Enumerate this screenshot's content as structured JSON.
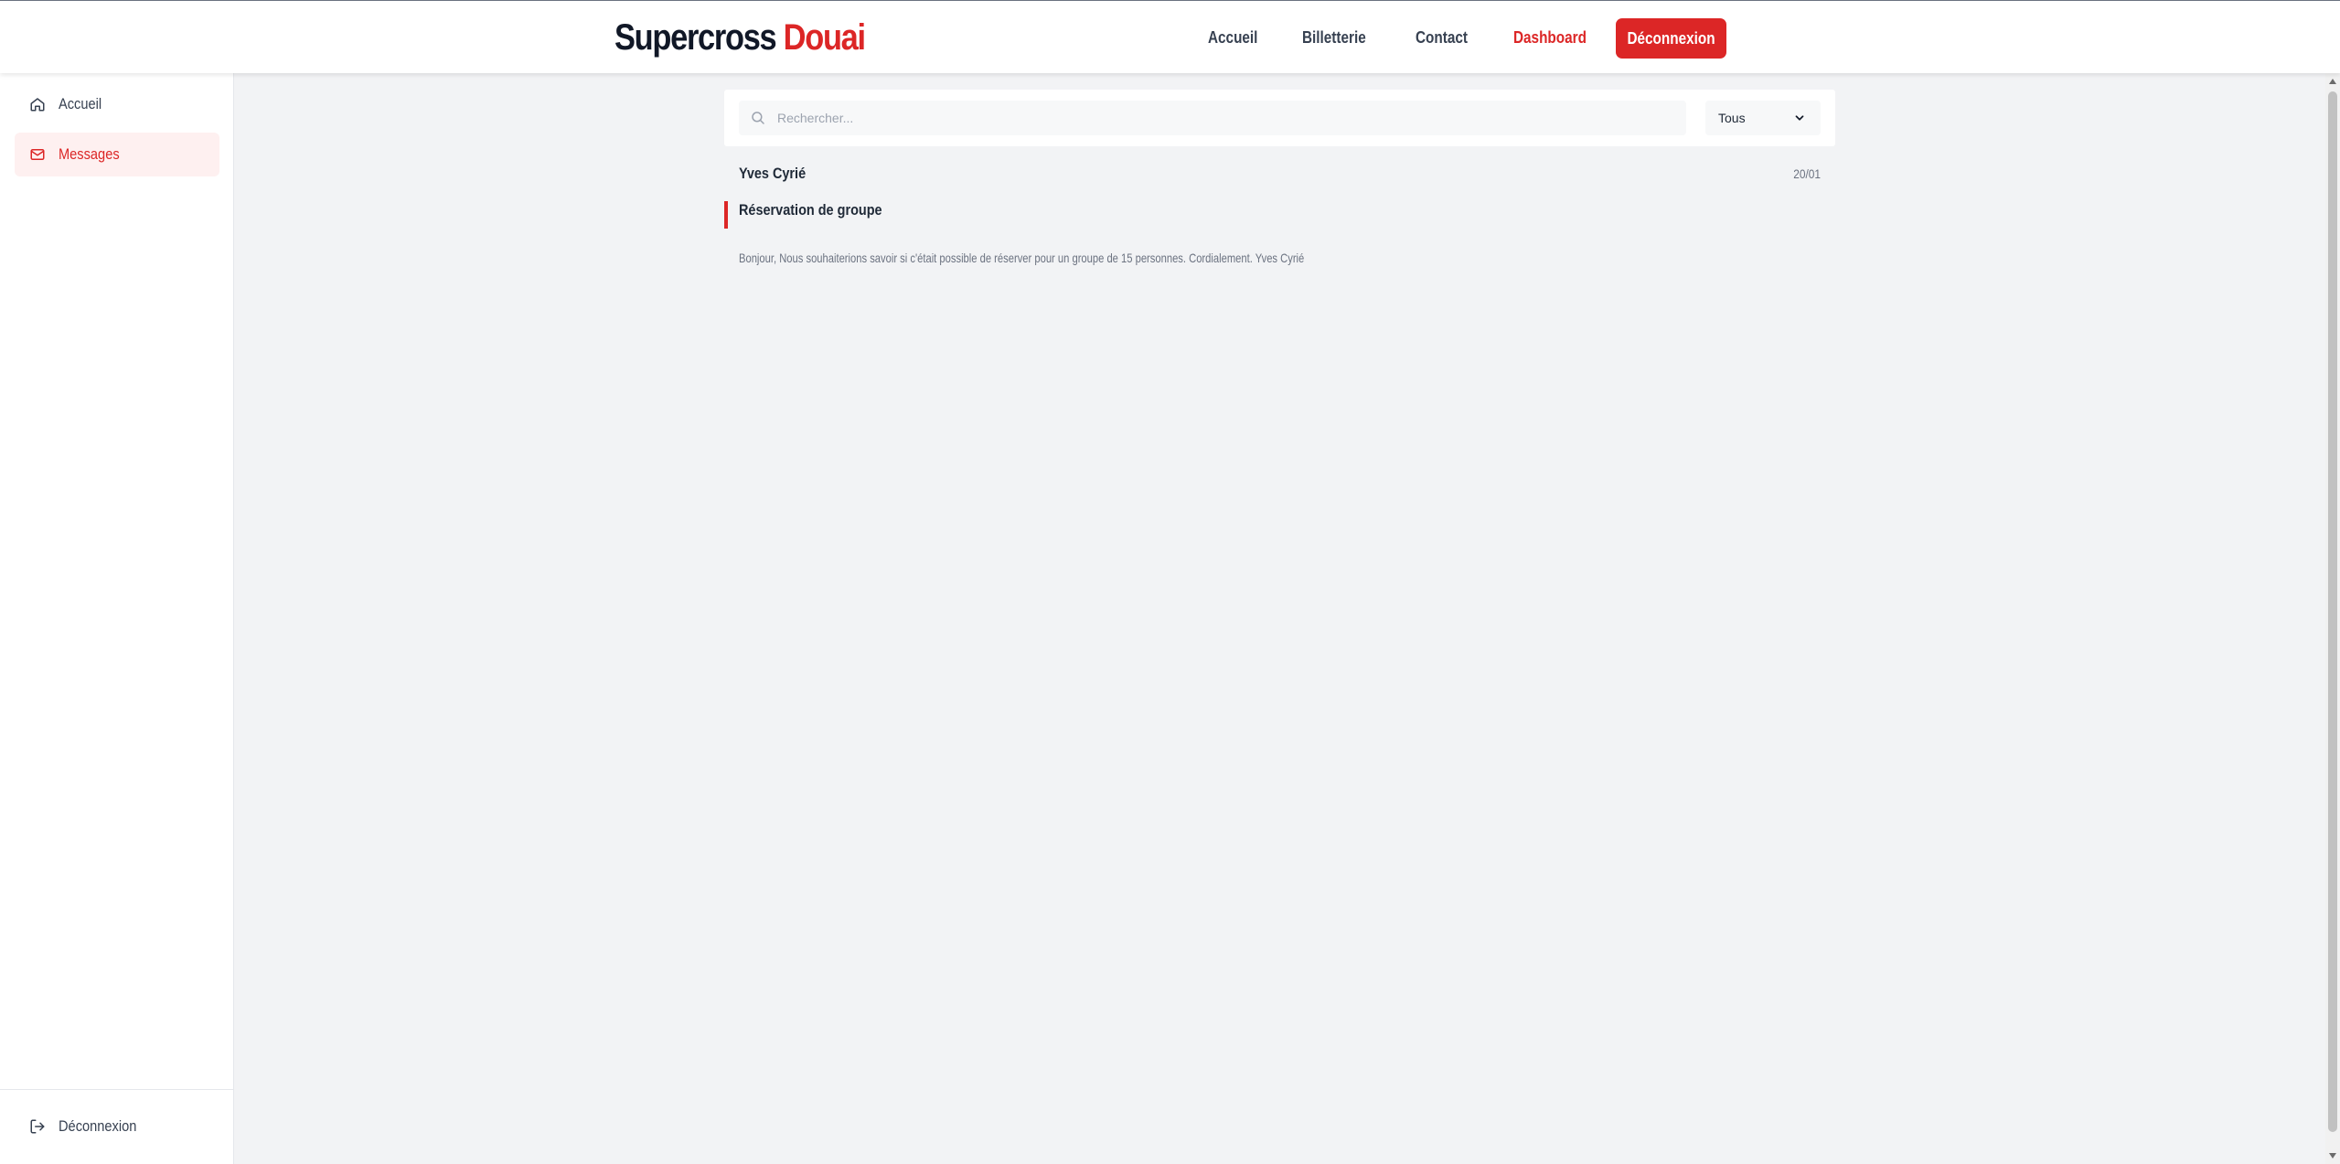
{
  "header": {
    "brand_primary": "Supercross",
    "brand_accent": "Douai",
    "nav": [
      "Accueil",
      "Billetterie",
      "Contact",
      "Dashboard"
    ],
    "active_nav": "Dashboard",
    "logout_label": "Déconnexion",
    "accent_color": "#dc2626"
  },
  "sidebar": {
    "items": [
      {
        "label": "Accueil",
        "icon": "home-icon"
      },
      {
        "label": "Messages",
        "icon": "mail-icon",
        "active": true
      }
    ],
    "footer_item": {
      "label": "Déconnexion",
      "icon": "logout-icon"
    }
  },
  "search": {
    "placeholder": "Rechercher...",
    "value": ""
  },
  "filter": {
    "selected": "Tous"
  },
  "messages": [
    {
      "sender": "Yves Cyrié",
      "date": "20/01",
      "subject": "Réservation de groupe",
      "body": "Bonjour, Nous souhaiterions savoir si c'était possible de réserver pour un groupe de 15 personnes. Cordialement. Yves Cyrié"
    }
  ]
}
